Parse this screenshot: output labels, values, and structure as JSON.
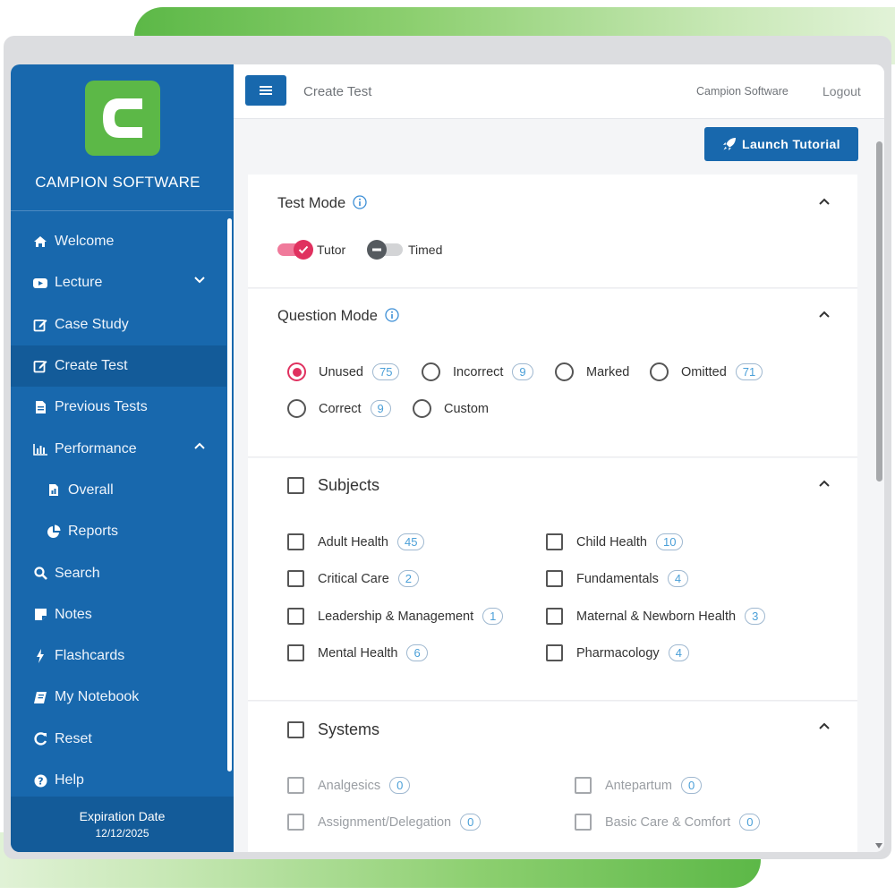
{
  "brand": {
    "name": "CAMPION SOFTWARE",
    "logo_letter": "C"
  },
  "nav": [
    {
      "label": "Welcome",
      "icon": "home-icon"
    },
    {
      "label": "Lecture",
      "icon": "video-icon",
      "caret": "down"
    },
    {
      "label": "Case Study",
      "icon": "edit-icon"
    },
    {
      "label": "Create Test",
      "icon": "edit-icon",
      "active": true
    },
    {
      "label": "Previous Tests",
      "icon": "document-icon"
    },
    {
      "label": "Performance",
      "icon": "bar-chart-icon",
      "caret": "up"
    },
    {
      "label": "Overall",
      "icon": "file-icon",
      "sub": true
    },
    {
      "label": "Reports",
      "icon": "pie-chart-icon",
      "sub": true
    },
    {
      "label": "Search",
      "icon": "search-icon"
    },
    {
      "label": "Notes",
      "icon": "note-icon"
    },
    {
      "label": "Flashcards",
      "icon": "bolt-icon"
    },
    {
      "label": "My Notebook",
      "icon": "book-icon"
    },
    {
      "label": "Reset",
      "icon": "reset-icon"
    },
    {
      "label": "Help",
      "icon": "help-icon"
    }
  ],
  "expiry": {
    "label": "Expiration Date",
    "date": "12/12/2025"
  },
  "topbar": {
    "title": "Create Test",
    "brand": "Campion Software",
    "logout": "Logout"
  },
  "launch_tutorial": "Launch Tutorial",
  "test_mode": {
    "title": "Test Mode",
    "options": [
      {
        "label": "Tutor",
        "on": true
      },
      {
        "label": "Timed",
        "on": false
      }
    ]
  },
  "question_mode": {
    "title": "Question Mode",
    "options": [
      {
        "label": "Unused",
        "count": "75",
        "checked": true
      },
      {
        "label": "Incorrect",
        "count": "9"
      },
      {
        "label": "Marked",
        "count": ""
      },
      {
        "label": "Omitted",
        "count": "71"
      },
      {
        "label": "Correct",
        "count": "9"
      },
      {
        "label": "Custom",
        "count": ""
      }
    ]
  },
  "subjects": {
    "title": "Subjects",
    "items": [
      {
        "label": "Adult Health",
        "count": "45"
      },
      {
        "label": "Child Health",
        "count": "10"
      },
      {
        "label": "Critical Care",
        "count": "2"
      },
      {
        "label": "Fundamentals",
        "count": "4"
      },
      {
        "label": "Leadership & Management",
        "count": "1"
      },
      {
        "label": "Maternal & Newborn Health",
        "count": "3"
      },
      {
        "label": "Mental Health",
        "count": "6"
      },
      {
        "label": "Pharmacology",
        "count": "4"
      }
    ]
  },
  "systems": {
    "title": "Systems",
    "items": [
      {
        "label": "Analgesics",
        "count": "0"
      },
      {
        "label": "Antepartum",
        "count": "0"
      },
      {
        "label": "Assignment/Delegation",
        "count": "0"
      },
      {
        "label": "Basic Care & Comfort",
        "count": "0"
      }
    ]
  },
  "colors": {
    "primary": "#1868ad",
    "accent": "#e0315f",
    "brand_green": "#5cb847",
    "badge_text": "#4a9fd8"
  }
}
